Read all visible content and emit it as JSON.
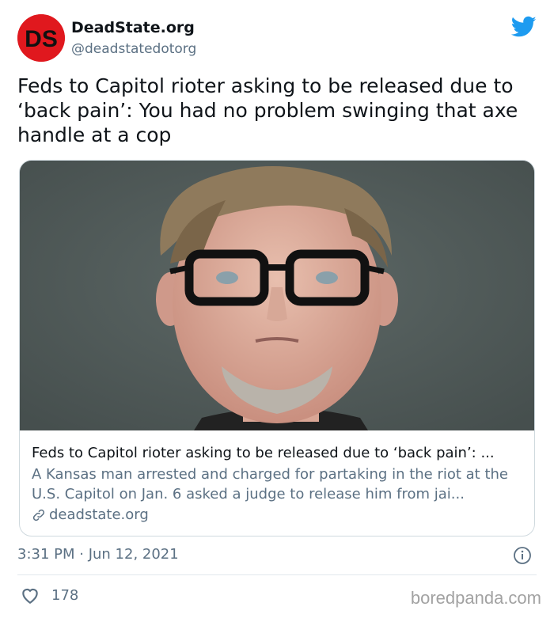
{
  "account": {
    "display_name": "DeadState.org",
    "handle": "@deadstatedotorg",
    "avatar_text": "DS"
  },
  "tweet": {
    "text": "Feds to Capitol rioter asking to be released due to ‘back pain’: You had no problem swinging that axe handle at a cop",
    "timestamp": "3:31 PM · Jun 12, 2021",
    "likes": "178"
  },
  "card": {
    "title": "Feds to Capitol rioter asking to be released due to ‘back pain’: ...",
    "description": "A Kansas man arrested and charged for partaking in the riot at the U.S. Capitol on Jan. 6 asked a judge to release him from jai...",
    "domain": "deadstate.org"
  },
  "watermark": "boredpanda.com",
  "icons": {
    "brand": "twitter-bird-icon",
    "link": "link-icon",
    "info": "info-icon",
    "like": "heart-icon"
  },
  "colors": {
    "twitter_blue": "#1d9bf0",
    "avatar_red": "#e0181e",
    "muted_text": "#5b7083",
    "border": "#cfd9de"
  }
}
